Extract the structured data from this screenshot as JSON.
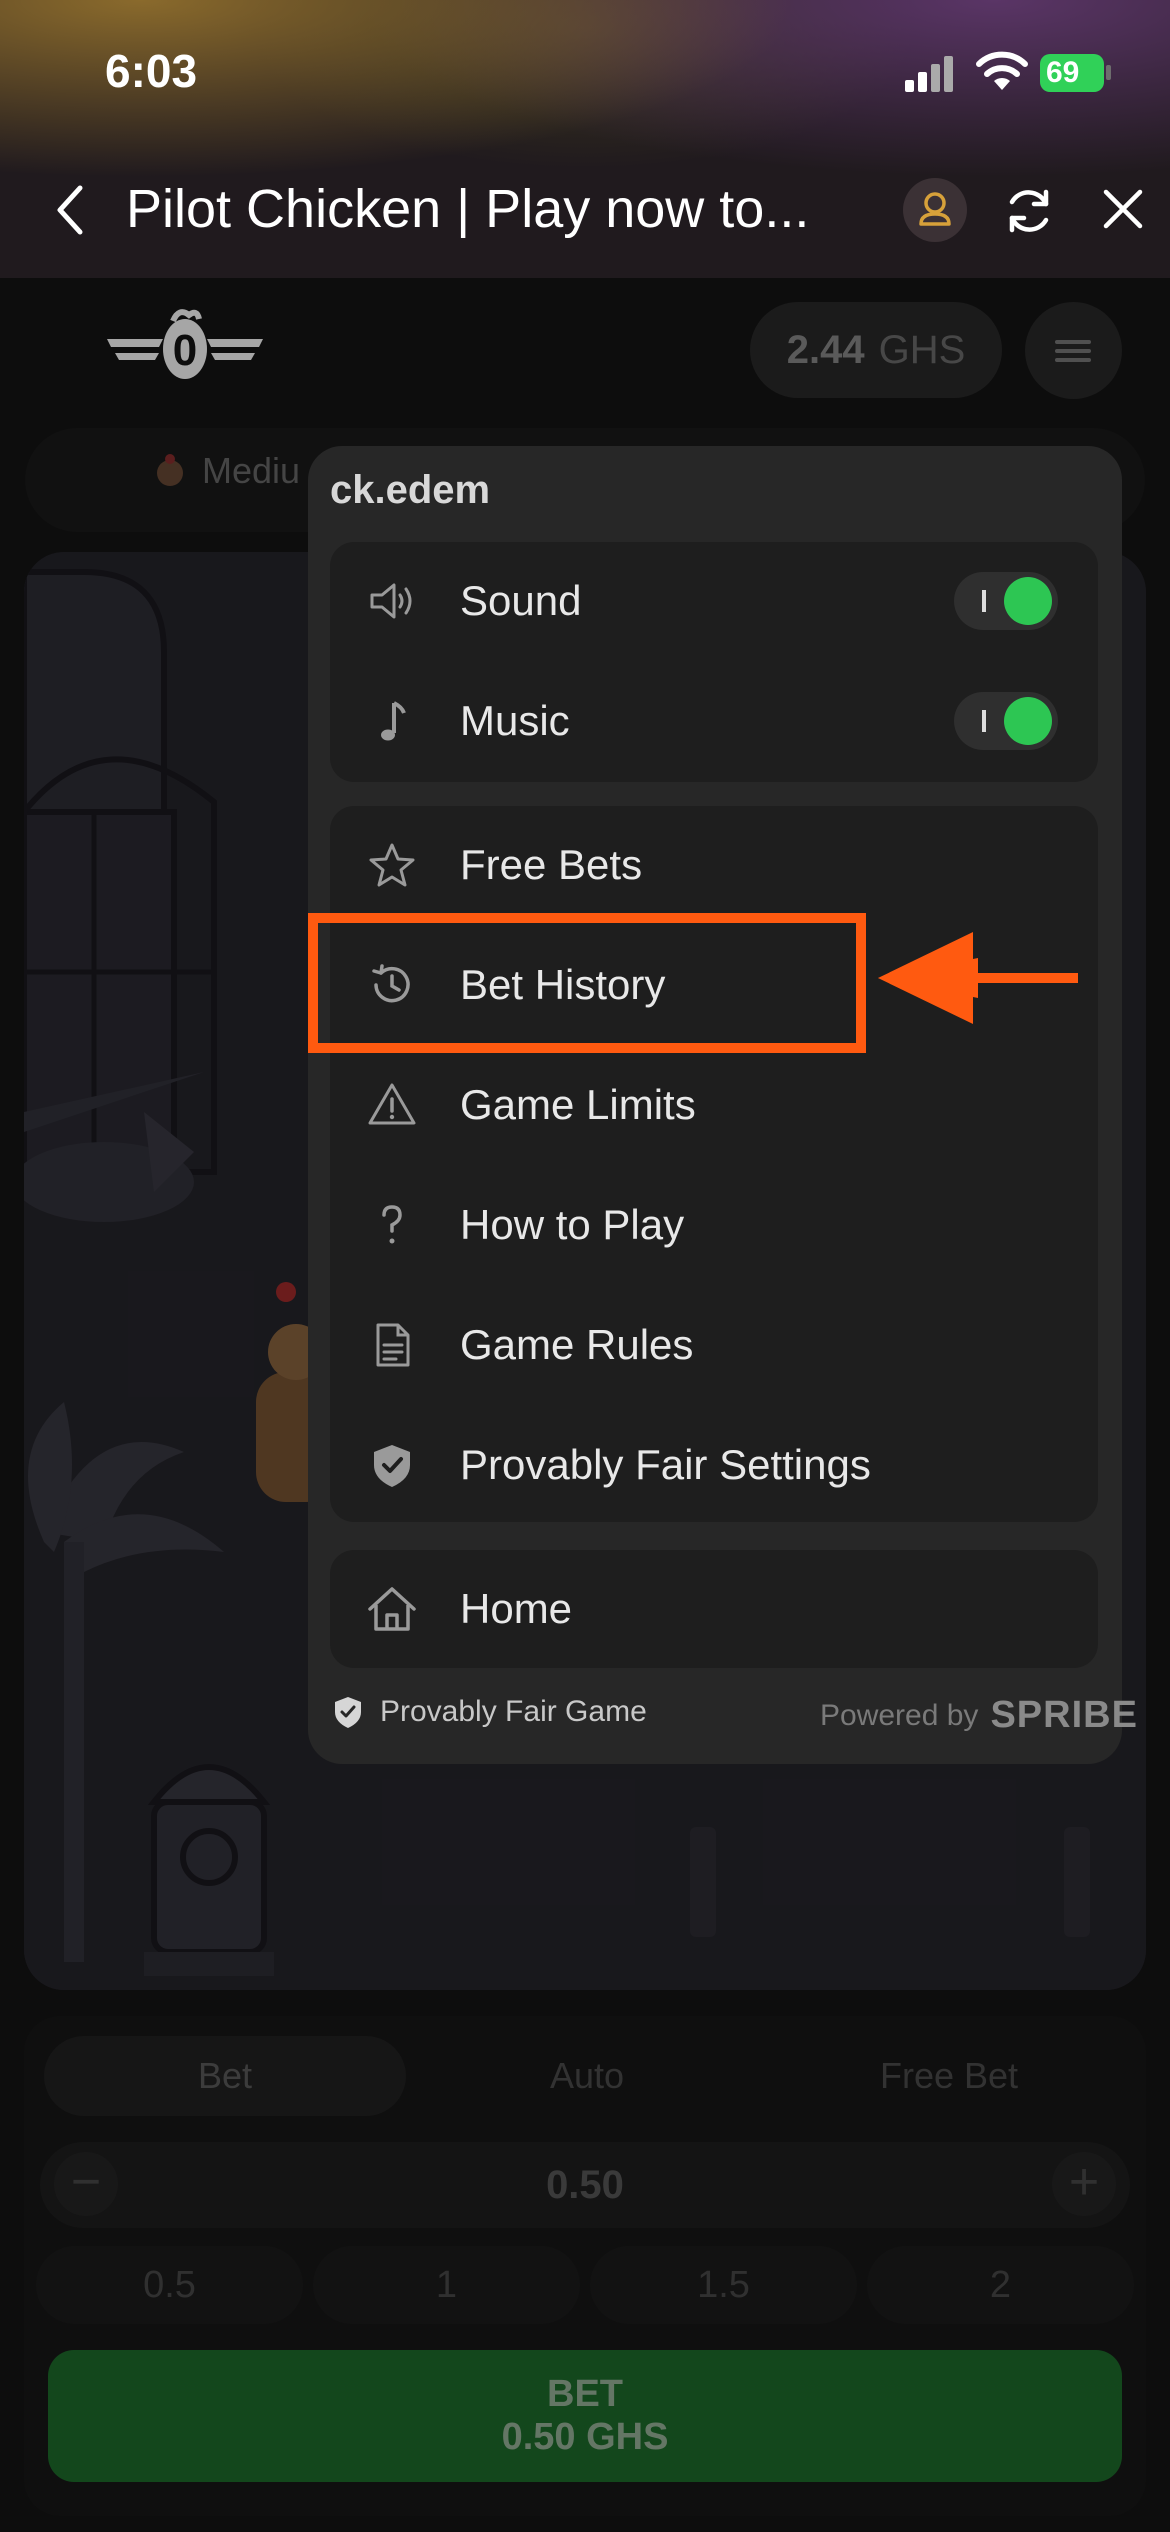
{
  "status_bar": {
    "time": "6:03",
    "battery": "69"
  },
  "browser": {
    "title": "Pilot Chicken | Play now to..."
  },
  "game_header": {
    "balance_amount": "2.44",
    "balance_currency": "GHS"
  },
  "difficulty": {
    "label": "Mediu"
  },
  "menu": {
    "username": "ck.edem",
    "toggles": [
      {
        "label": "Sound",
        "icon": "speaker-icon",
        "on": true
      },
      {
        "label": "Music",
        "icon": "music-note-icon",
        "on": true
      }
    ],
    "items": [
      {
        "label": "Free Bets",
        "icon": "star-icon"
      },
      {
        "label": "Bet History",
        "icon": "history-icon"
      },
      {
        "label": "Game Limits",
        "icon": "warning-icon"
      },
      {
        "label": "How to Play",
        "icon": "question-icon"
      },
      {
        "label": "Game Rules",
        "icon": "document-icon"
      },
      {
        "label": "Provably Fair Settings",
        "icon": "shield-check-icon"
      }
    ],
    "home": {
      "label": "Home",
      "icon": "home-icon"
    },
    "footer": {
      "provably_fair": "Provably Fair Game",
      "powered_by": "Powered by",
      "brand": "SPRIBE"
    }
  },
  "bet_panel": {
    "tabs": [
      "Bet",
      "Auto",
      "Free Bet"
    ],
    "amount": "0.50",
    "minus": "−",
    "plus": "+",
    "quick_amounts": [
      "0.5",
      "1",
      "1.5",
      "2"
    ],
    "bet_button": {
      "line1": "BET",
      "line2": "0.50 GHS"
    }
  },
  "colors": {
    "accent_green": "#2dc653",
    "highlight_orange": "#ff5a10",
    "bet_green": "#1e6e2c"
  }
}
